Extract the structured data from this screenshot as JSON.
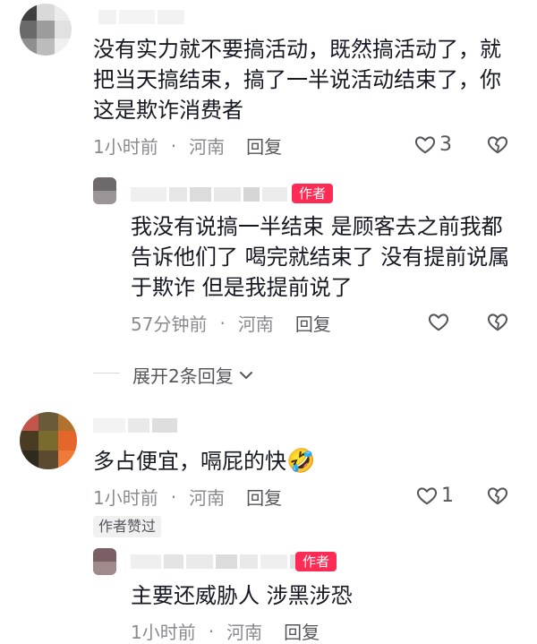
{
  "comments": [
    {
      "text": "没有实力就不要搞活动，既然搞活动了，就把当天搞结束，搞了一半说活动结束了，你这是欺诈消费者",
      "time": "1小时前",
      "location": "河南",
      "reply_label": "回复",
      "like_count": "3"
    },
    {
      "text": "多占便宜，嗝屁的快",
      "emoji": "🤣",
      "time": "1小时前",
      "location": "河南",
      "reply_label": "回复",
      "like_count": "1",
      "author_liked_label": "作者赞过"
    }
  ],
  "replies": [
    {
      "badge": "作者",
      "text": "我没有说搞一半结束 是顾客去之前我都告诉他们了 喝完就结束了 没有提前说属于欺诈 但是我提前说了",
      "time": "57分钟前",
      "location": "河南",
      "reply_label": "回复"
    },
    {
      "badge": "作者",
      "text": "主要还威胁人 涉黑涉恐",
      "time": "1小时前",
      "location": "河南",
      "reply_label": "回复"
    }
  ],
  "expand_label": "展开2条回复",
  "separator": "·",
  "colors": {
    "accent": "#fe2c55",
    "meta": "#8a8b91",
    "text": "#161823"
  },
  "icons": [
    "heart-outline-icon",
    "broken-heart-icon",
    "chevron-down-icon"
  ]
}
